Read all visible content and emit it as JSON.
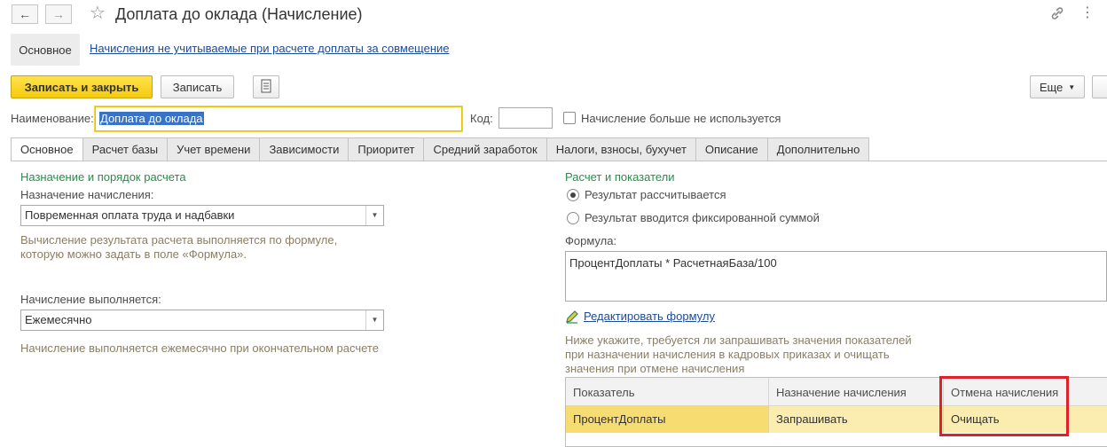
{
  "window": {
    "title": "Доплата до оклада (Начисление)",
    "back_icon": "arrow-left-icon",
    "forward_icon": "arrow-right-icon",
    "favorite_icon": "star-icon",
    "link_icon": "link-icon",
    "more_icon": "more-vertical-icon"
  },
  "nav": {
    "main_label": "Основное",
    "link_label": "Начисления не учитываемые при расчете доплаты за совмещение"
  },
  "toolbar": {
    "save_close_label": "Записать и закрыть",
    "save_label": "Записать",
    "doc_icon": "document-list-icon",
    "more_label": "Еще"
  },
  "header": {
    "name_label": "Наименование:",
    "name_value": "Доплата до оклада",
    "code_label": "Код:",
    "code_value": "",
    "unused_label": "Начисление больше не используется"
  },
  "tabs": [
    {
      "label": "Основное"
    },
    {
      "label": "Расчет базы"
    },
    {
      "label": "Учет времени"
    },
    {
      "label": "Зависимости"
    },
    {
      "label": "Приоритет"
    },
    {
      "label": "Средний заработок"
    },
    {
      "label": "Налоги, взносы, бухучет"
    },
    {
      "label": "Описание"
    },
    {
      "label": "Дополнительно"
    }
  ],
  "left": {
    "group_title": "Назначение и порядок расчета",
    "purpose_label": "Назначение начисления:",
    "purpose_value": "Повременная оплата труда и надбавки",
    "purpose_hint_1": "Вычисление результата расчета выполняется по формуле,",
    "purpose_hint_2": "которую можно задать в поле «Формула».",
    "period_label": "Начисление выполняется:",
    "period_value": "Ежемесячно",
    "period_hint": "Начисление выполняется ежемесячно при окончательном расчете"
  },
  "right": {
    "group_title": "Расчет и показатели",
    "radio_calc": "Результат рассчитывается",
    "radio_fixed": "Результат вводится фиксированной суммой",
    "formula_label": "Формула:",
    "formula_value": "ПроцентДоплаты * РасчетнаяБаза/100",
    "edit_formula_link": "Редактировать формулу",
    "edit_icon": "pencil-icon",
    "hint_1": "Ниже укажите, требуется ли запрашивать значения показателей",
    "hint_2": "при назначении начисления в кадровых приказах и очищать",
    "hint_3": "значения при отмене начисления"
  },
  "table": {
    "columns": [
      "Показатель",
      "Назначение начисления",
      "Отмена начисления"
    ],
    "rows": [
      [
        "ПроцентДоплаты",
        "Запрашивать",
        "Очищать"
      ]
    ]
  },
  "colors": {
    "accent_primary": "#f5cb0d",
    "group_title": "#2c8a4a",
    "link": "#1c4a95",
    "highlight_frame": "#e0202a",
    "selected_row": "#fbecb0"
  }
}
